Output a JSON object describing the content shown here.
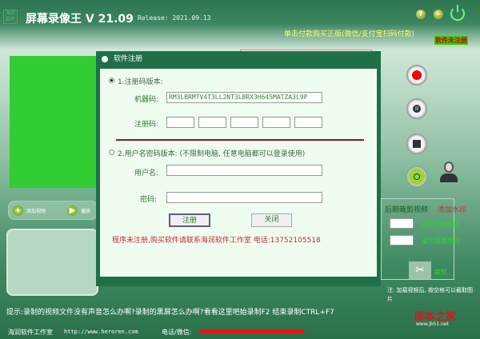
{
  "app": {
    "logo_text": "海润软件",
    "title": "屏幕录像王 V 21.09",
    "release": "Release: 2021.09.13",
    "buy_link": "单击付款购买正版(微信/支付宝扫码付款)",
    "unregistered_badge": "软件未注册",
    "help": "?",
    "minimize": "−"
  },
  "dialog": {
    "title": "软件注册",
    "option1": "1.注册码版本:",
    "machine_label": "机器码:",
    "machine_code": "RM3LBRMTV4T3LL2NT3LBRX3H645MATZA3L9P",
    "reg_label": "注册码:",
    "option2": "2.用户名密码版本: (不限制电脑, 任意电脑都可以登录使用)",
    "user_label": "用户名:",
    "pass_label": "密码:",
    "register_button": "注册",
    "close_button": "关闭",
    "notice": "程序未注册,购买软件请联系海润软件工作室 电话:13752105518"
  },
  "left": {
    "add_video": "添加视频",
    "play": "播放"
  },
  "right": {
    "trim_title": "后期裁剪视频",
    "watermark": "添加水印",
    "set_start": "设为开始时间",
    "set_end": "设为结束时间",
    "cut": "裁剪",
    "note": "注: 加载视频后, 按空格可以截取图片"
  },
  "hint": "提示:录制的视频文件没有声音怎么办啊?录制的黑屏怎么办啊?看看这里吧始录制F2  结束录制CTRL+F7",
  "footer": {
    "studio": "海润软件工作室",
    "url": "http://www.heroren.com",
    "phone_label": "电话/微信:"
  },
  "watermark": {
    "text": "脚本之家",
    "url": "www.jb51.net"
  }
}
